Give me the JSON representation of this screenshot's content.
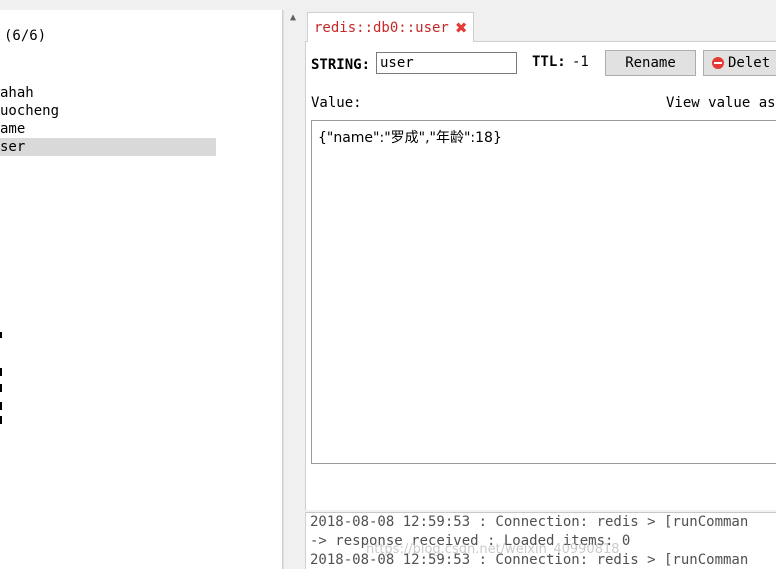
{
  "tree": {
    "count": "(6/6)",
    "items": [
      {
        "label": "ahah"
      },
      {
        "label": "uocheng"
      },
      {
        "label": "ame"
      },
      {
        "label": "ser"
      }
    ]
  },
  "tab": {
    "title": "redis::db0::user"
  },
  "key_editor": {
    "type_label": "STRING:",
    "key_value": "user",
    "ttl_label": "TTL:",
    "ttl_value": "-1",
    "rename_label": "Rename",
    "delete_label": "Delet",
    "value_label": "Value:",
    "view_as_label": "View value as",
    "value_text": "{\"name\":\"罗成\",\"年龄\":18}"
  },
  "log": {
    "lines": [
      "2018-08-08 12:59:53 : Connection: redis > [runComman",
      "-> response received : Loaded items: 0",
      "2018-08-08 12:59:53 : Connection: redis > [runComman"
    ],
    "watermark": "https://blog.csdn.net/weixin_40990818"
  },
  "colors": {
    "tab_text": "#c62828",
    "close_icon": "#e53935",
    "selected_row": "#d9d9d9"
  }
}
